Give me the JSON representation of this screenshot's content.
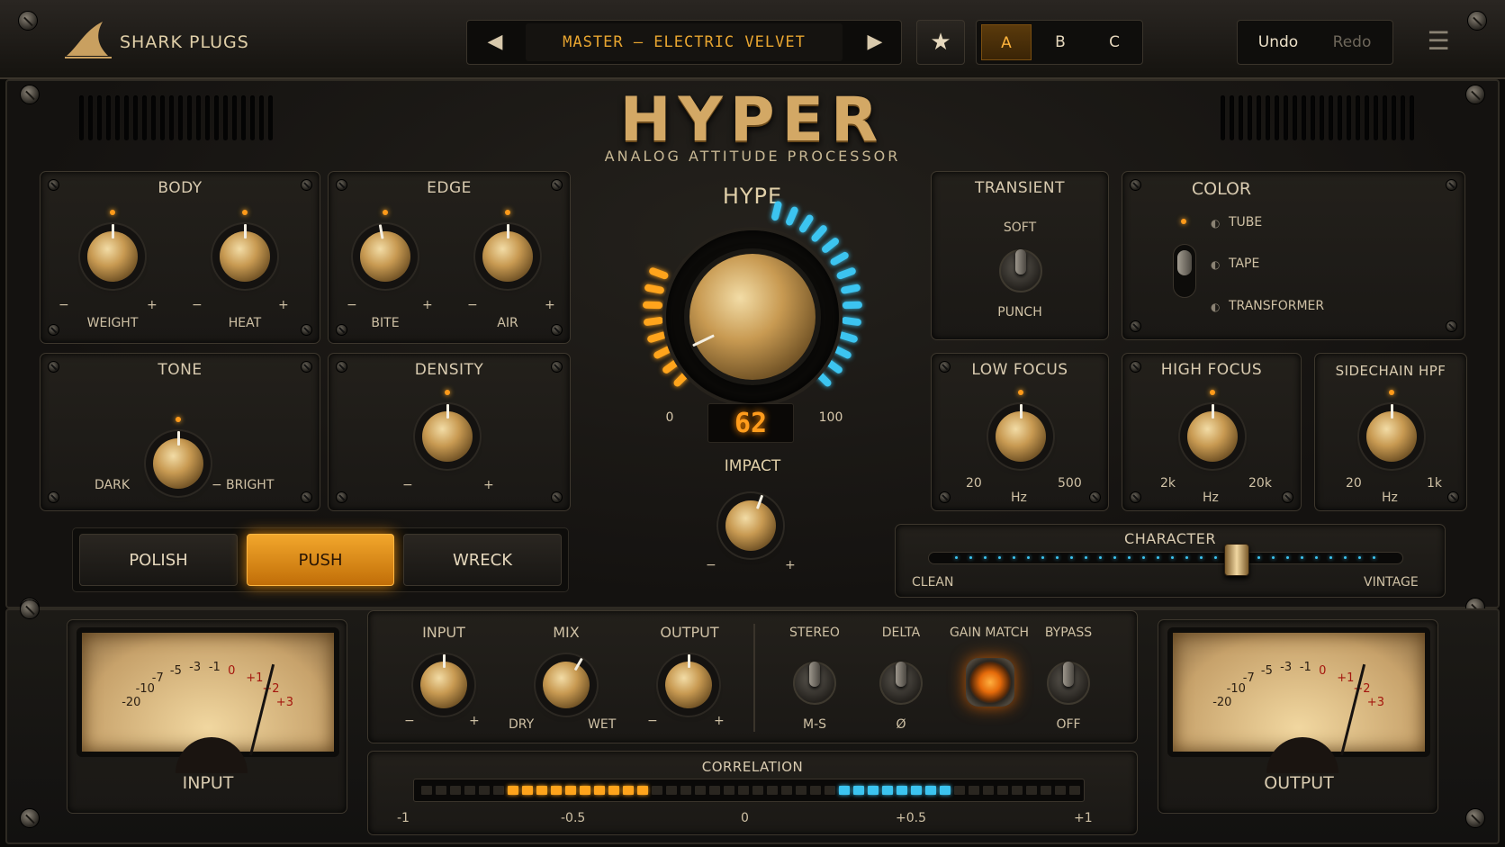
{
  "header": {
    "brand": "SHARK PLUGS",
    "preset_name": "MASTER — ELECTRIC VELVET",
    "prev_icon": "◀",
    "next_icon": "▶",
    "favorite_icon": "★",
    "snapshots": [
      "A",
      "B",
      "C"
    ],
    "active_snapshot": "A",
    "undo": "Undo",
    "redo": "Redo",
    "menu_icon": "☰"
  },
  "title": {
    "name": "HYPER",
    "subtitle": "ANALOG ATTITUDE PROCESSOR"
  },
  "body": {
    "title": "BODY",
    "weight": "WEIGHT",
    "heat": "HEAT",
    "minus": "−",
    "plus": "+"
  },
  "edge": {
    "title": "EDGE",
    "bite": "BITE",
    "air": "AIR",
    "minus": "−",
    "plus": "+"
  },
  "tone": {
    "title": "TONE",
    "left": "DARK",
    "right": "BRIGHT",
    "sep": "−"
  },
  "density": {
    "title": "DENSITY",
    "minus": "−",
    "plus": "+"
  },
  "modes": {
    "items": [
      "POLISH",
      "PUSH",
      "WRECK"
    ],
    "active": "PUSH"
  },
  "hype": {
    "title": "HYPE",
    "min": "0",
    "max": "100",
    "value": "62",
    "value_num": 62
  },
  "impact": {
    "title": "IMPACT",
    "minus": "−",
    "plus": "+"
  },
  "transient": {
    "title": "TRANSIENT",
    "top": "SOFT",
    "bottom": "PUNCH"
  },
  "color": {
    "title": "COLOR",
    "options": [
      "TUBE",
      "TAPE",
      "TRANSFORMER"
    ],
    "selected": "TUBE"
  },
  "low_focus": {
    "title": "LOW FOCUS",
    "min": "20",
    "max": "500",
    "unit": "Hz"
  },
  "high_focus": {
    "title": "HIGH FOCUS",
    "min": "2k",
    "max": "20k",
    "unit": "Hz"
  },
  "sidechain": {
    "title": "SIDECHAIN HPF",
    "min": "20",
    "max": "1k",
    "unit": "Hz"
  },
  "character": {
    "title": "CHARACTER",
    "left": "CLEAN",
    "right": "VINTAGE",
    "value_fraction": 0.65
  },
  "vu_scale": [
    "-20",
    "-10",
    "-7",
    "-5",
    "-3",
    "-1",
    "0",
    "+1",
    "+2",
    "+3"
  ],
  "input_meter": {
    "label": "INPUT"
  },
  "output_meter": {
    "label": "OUTPUT"
  },
  "gain": {
    "input": "INPUT",
    "mix": "MIX",
    "output": "OUTPUT",
    "minus": "−",
    "plus": "+",
    "dry": "DRY",
    "wet": "WET"
  },
  "switches": {
    "stereo": "STEREO",
    "stereo_sub": "M-S",
    "delta": "DELTA",
    "delta_sub": "Ø",
    "gain_match": "GAIN MATCH",
    "bypass": "BYPASS",
    "bypass_sub": "OFF"
  },
  "correlation": {
    "title": "CORRELATION",
    "ticks": [
      "-1",
      "-0.5",
      "0",
      "+0.5",
      "+1"
    ]
  },
  "colors": {
    "gold": "#d8b070",
    "amber": "#ffa41c",
    "cyan": "#3cc4f0"
  }
}
